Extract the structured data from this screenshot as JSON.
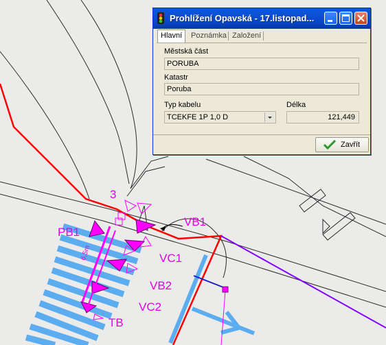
{
  "window": {
    "title": "Prohlížení Opavská - 17.listopad...",
    "controls": [
      "minimize-icon",
      "maximize-icon",
      "close-icon"
    ],
    "tabs": [
      {
        "label": "Hlavní",
        "active": true
      },
      {
        "label": "Poznámka",
        "active": false
      },
      {
        "label": "Založení",
        "active": false
      }
    ],
    "fields": {
      "district_label": "Městská část",
      "district_value": "PORUBA",
      "cadastre_label": "Katastr",
      "cadastre_value": "Poruba",
      "cable_type_label": "Typ kabelu",
      "cable_type_value": "TCEKFE 1P 1,0 D",
      "length_label": "Délka",
      "length_value": "121,449"
    },
    "close_button": "Zavřít"
  },
  "map": {
    "labels": {
      "l3": "3",
      "pb1": "PB1",
      "vb1": "VB1",
      "vc1": "VC1",
      "vb2": "VB2",
      "vc2": "VC2",
      "tb": "TB",
      "dim": "6,5m"
    },
    "colors": {
      "background": "#ebebe9",
      "cable": "#ff0000",
      "route": "#8000ff",
      "crosswalk": "#5cacf0",
      "marker": "#ff00ff"
    }
  }
}
